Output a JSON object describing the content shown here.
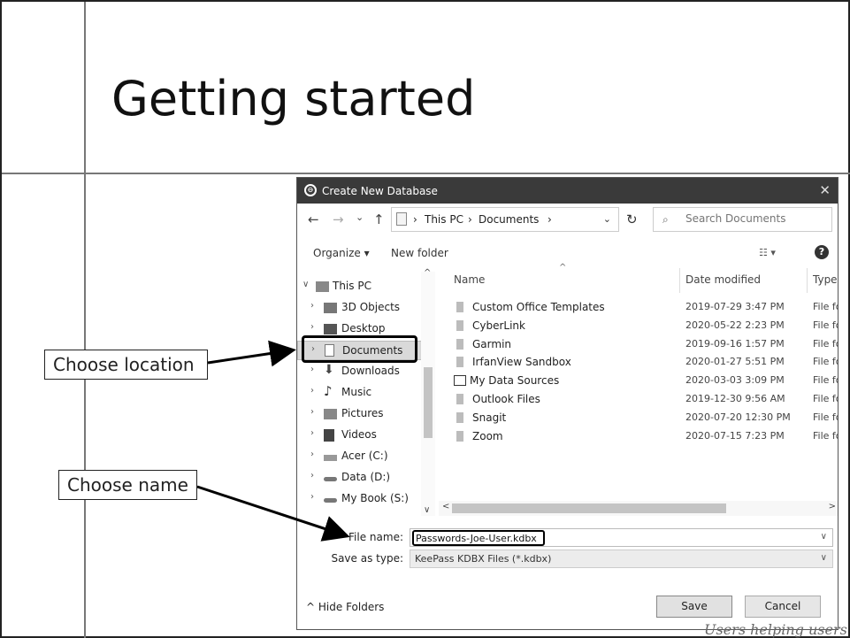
{
  "slide": {
    "title": "Getting started",
    "watermark": "Users helping users"
  },
  "callouts": {
    "location": "Choose location",
    "name": "Choose name"
  },
  "dialog": {
    "title": "Create New Database",
    "close_glyph": "✕",
    "nav": {
      "back": "←",
      "forward": "→",
      "recent": "⌄",
      "up": "↑",
      "breadcrumb": [
        "This PC",
        "Documents"
      ],
      "separator": "›",
      "refresh": "↻",
      "search_placeholder": "Search Documents"
    },
    "toolbar": {
      "organize": "Organize ▾",
      "new_folder": "New folder",
      "help": "?"
    },
    "tree": {
      "root": "This PC",
      "items": [
        "3D Objects",
        "Desktop",
        "Documents",
        "Downloads",
        "Music",
        "Pictures",
        "Videos",
        "Acer (C:)",
        "Data (D:)",
        "My Book (S:)"
      ],
      "selected": "Documents"
    },
    "columns": {
      "name": "Name",
      "date": "Date modified",
      "type": "Type"
    },
    "files": [
      {
        "name": "Custom Office Templates",
        "date": "2019-07-29 3:47 PM",
        "type": "File fo"
      },
      {
        "name": "CyberLink",
        "date": "2020-05-22 2:23 PM",
        "type": "File fo"
      },
      {
        "name": "Garmin",
        "date": "2019-09-16 1:57 PM",
        "type": "File fo"
      },
      {
        "name": "IrfanView Sandbox",
        "date": "2020-01-27 5:51 PM",
        "type": "File fo"
      },
      {
        "name": "My Data Sources",
        "date": "2020-03-03 3:09 PM",
        "type": "File fo"
      },
      {
        "name": "Outlook Files",
        "date": "2019-12-30 9:56 AM",
        "type": "File fo"
      },
      {
        "name": "Snagit",
        "date": "2020-07-20 12:30 PM",
        "type": "File fo"
      },
      {
        "name": "Zoom",
        "date": "2020-07-15 7:23 PM",
        "type": "File fo"
      }
    ],
    "form": {
      "file_name_label": "File name:",
      "file_name_value": "Passwords-Joe-User.kdbx",
      "save_type_label": "Save as type:",
      "save_type_value": "KeePass KDBX Files (*.kdbx)"
    },
    "footer": {
      "hide_folders": "Hide Folders",
      "save": "Save",
      "cancel": "Cancel"
    }
  }
}
